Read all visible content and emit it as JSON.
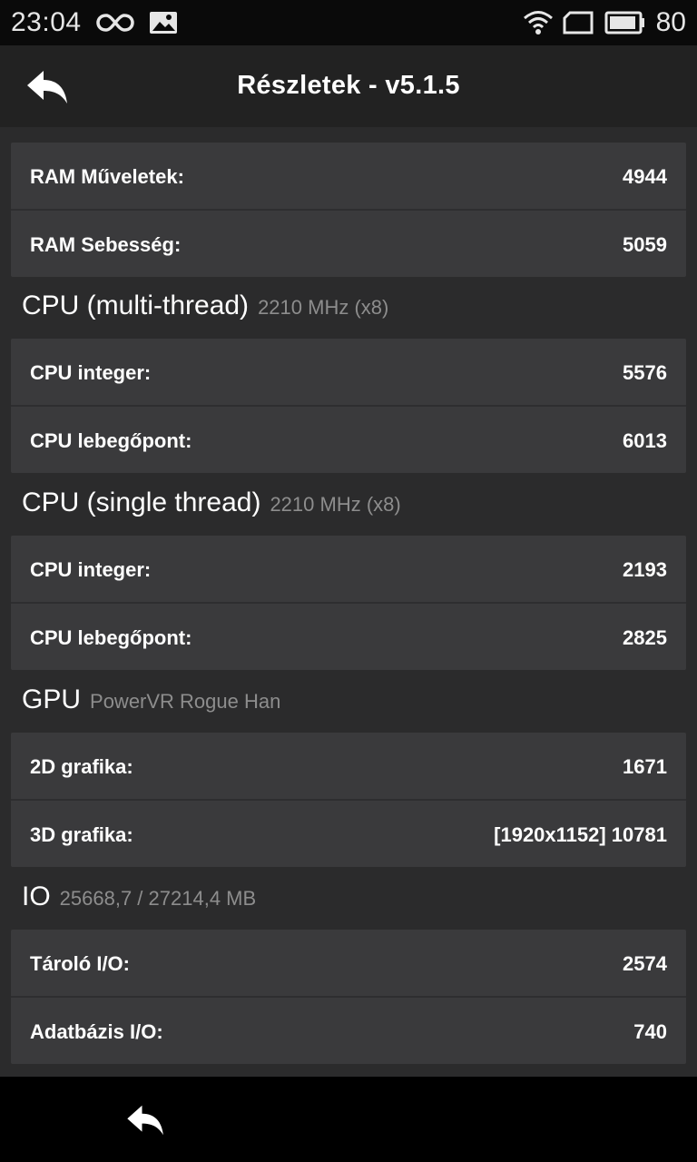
{
  "status_bar": {
    "time": "23:04",
    "battery": "80",
    "icons": [
      "infinity-icon",
      "image-icon",
      "wifi-icon",
      "sim-icon",
      "battery-icon"
    ]
  },
  "action_bar": {
    "title": "Részletek - v5.1.5",
    "back_icon": "back-arrow-icon"
  },
  "ram": {
    "rows": [
      {
        "label": "RAM Műveletek:",
        "value": "4944"
      },
      {
        "label": "RAM Sebesség:",
        "value": "5059"
      }
    ]
  },
  "cpu_multi": {
    "title": "CPU (multi-thread)",
    "subtitle": "2210 MHz (x8)",
    "rows": [
      {
        "label": "CPU integer:",
        "value": "5576"
      },
      {
        "label": "CPU lebegőpont:",
        "value": "6013"
      }
    ]
  },
  "cpu_single": {
    "title": "CPU (single thread)",
    "subtitle": "2210 MHz (x8)",
    "rows": [
      {
        "label": "CPU integer:",
        "value": "2193"
      },
      {
        "label": "CPU lebegőpont:",
        "value": "2825"
      }
    ]
  },
  "gpu": {
    "title": "GPU",
    "subtitle": "PowerVR Rogue Han",
    "rows": [
      {
        "label": "2D grafika:",
        "value": "1671"
      },
      {
        "label": "3D grafika:",
        "value": "[1920x1152] 10781"
      }
    ]
  },
  "io": {
    "title": "IO",
    "subtitle": "25668,7 / 27214,4 MB",
    "rows": [
      {
        "label": "Tároló I/O:",
        "value": "2574"
      },
      {
        "label": "Adatbázis I/O:",
        "value": "740"
      }
    ]
  },
  "nav_bar": {
    "back_icon": "nav-back-icon"
  }
}
